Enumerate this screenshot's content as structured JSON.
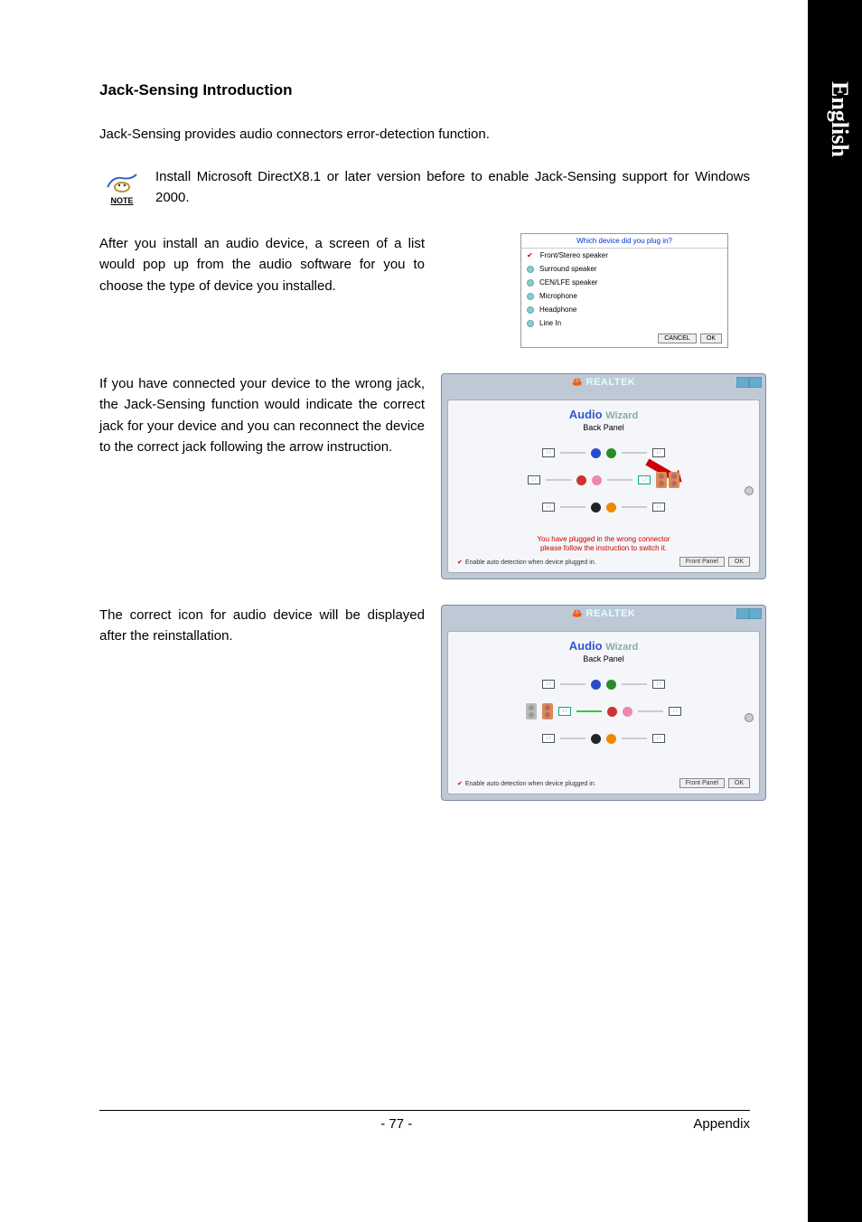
{
  "language_tab": "English",
  "heading": "Jack-Sensing Introduction",
  "intro": "Jack-Sensing provides audio connectors error-detection function.",
  "note_label": "NOTE",
  "note_text": "Install Microsoft DirectX8.1 or later version before to enable Jack-Sensing support for Windows 2000.",
  "para_install": "After you install an audio device, a screen of a list would pop up from the audio software for you to choose the type of device you installed.",
  "para_wrong": "If you have connected your device to the wrong jack, the Jack-Sensing function would indicate the correct jack for your device and you can reconnect the device to the correct jack following the arrow instruction.",
  "para_correct": "The correct icon for audio device will be displayed after the reinstallation.",
  "dialog1": {
    "title": "Which device did you plug in?",
    "opts": [
      "Front/Stereo speaker",
      "Surround speaker",
      "CEN/LFE speaker",
      "Microphone",
      "Headphone",
      "Line In"
    ],
    "cancel": "CANCEL",
    "ok": "OK"
  },
  "realtek": {
    "brand": "REALTEK",
    "aw": "Audio",
    "wiz": "Wizard",
    "sub": "Back Panel",
    "warn1": "You have plugged in the wrong connector",
    "warn2": "please follow the instruction to switch it.",
    "chk": "Enable auto detection when device plugged in.",
    "front_panel": "Front Panel",
    "ok": "OK"
  },
  "footer": {
    "page": "- 77 -",
    "section": "Appendix"
  }
}
